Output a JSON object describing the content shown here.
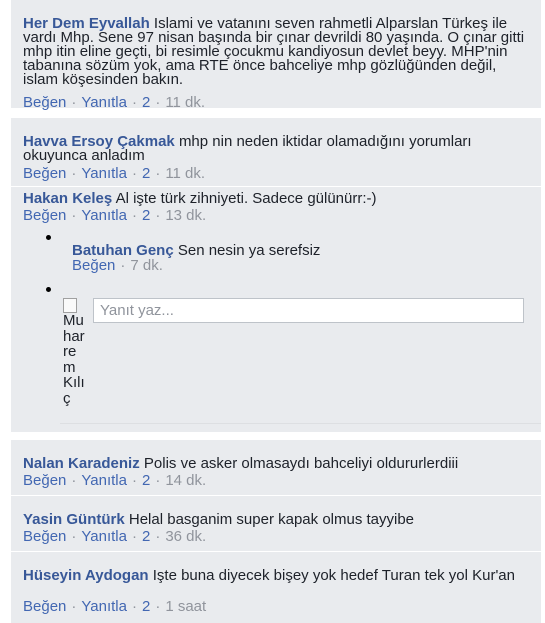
{
  "comments": [
    {
      "author": "Her Dem Eyvallah",
      "text": "Islami ve vatanını seven rahmetli Alparslan Türkeş ile vardı Mhp. Sene 97 nisan başında bir çınar devrildi 80 yaşında. O çınar gitti mhp itin eline geçti, bi resimle çocukmu kandiyosun devlet beyy. MHP'nin tabanına sözüm yok, ama RTE önce bahceliye mhp gözlüğünden değil, islam köşesinden bakın.",
      "like": "Beğen",
      "reply": "Yanıtla",
      "count": "2",
      "time": "11 dk."
    },
    {
      "author": "Havva Ersoy Çakmak",
      "text": "mhp nin neden iktidar olamadığını yorumları okuyunca anladım",
      "like": "Beğen",
      "reply": "Yanıtla",
      "count": "2",
      "time": "11 dk."
    },
    {
      "author": "Hakan Keleş",
      "text": "Al işte türk zihniyeti. Sadece gülünürr:-)",
      "like": "Beğen",
      "reply": "Yanıtla",
      "count": "2",
      "time": "13 dk."
    },
    {
      "author": "Nalan Karadeniz",
      "text": "Polis ve asker olmasaydı bahceliyi oldururlerdiii",
      "like": "Beğen",
      "reply": "Yanıtla",
      "count": "2",
      "time": "14 dk."
    },
    {
      "author": "Yasin Güntürk",
      "text": "Helal basganim super kapak olmus tayyibe",
      "like": "Beğen",
      "reply": "Yanıtla",
      "count": "2",
      "time": "36 dk."
    },
    {
      "author": "Hüseyin Aydogan",
      "text": "Işte buna diyecek bişey yok hedef Turan tek yol Kur'an",
      "like": "Beğen",
      "reply": "Yanıtla",
      "count": "2",
      "time": "1 saat"
    }
  ],
  "reply": {
    "author": "Batuhan Genç",
    "text": "Sen nesin ya serefsiz",
    "like": "Beğen",
    "time": "7 dk."
  },
  "composer": {
    "avatar_alt": "Muharrem Kılıç",
    "placeholder": "Yanıt yaz..."
  }
}
